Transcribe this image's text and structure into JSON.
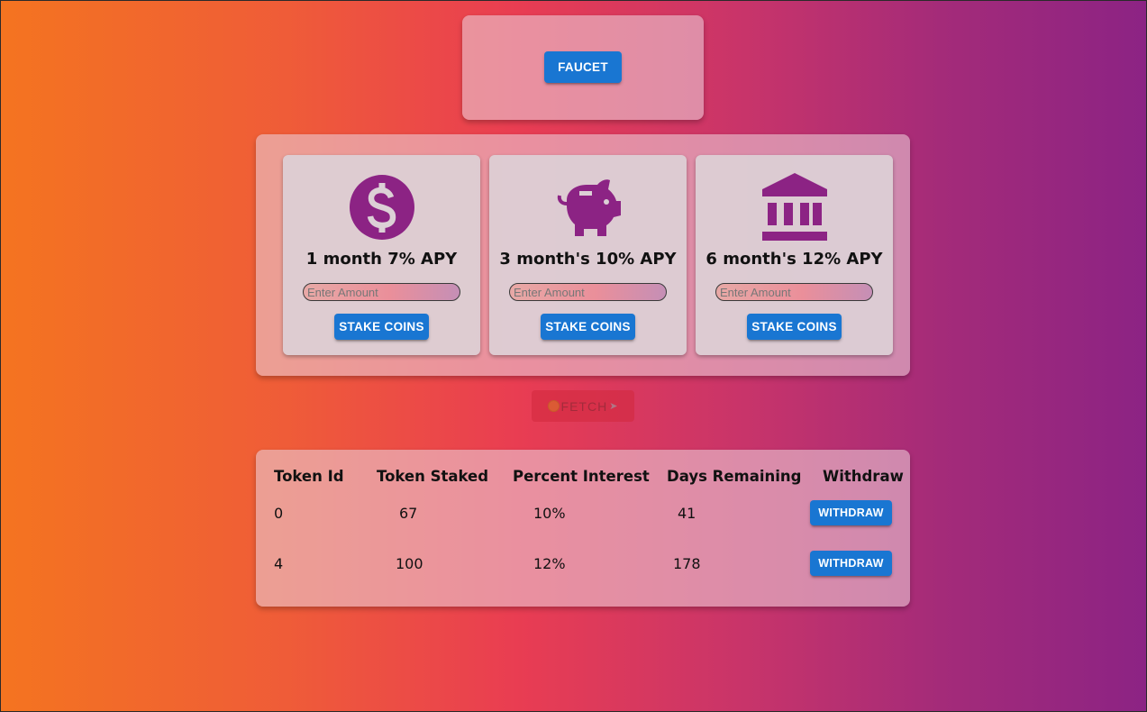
{
  "faucet": {
    "label": "FAUCET"
  },
  "plans": [
    {
      "icon": "dollar-circle-icon",
      "label": "1 month 7% APY",
      "placeholder": "Enter Amount",
      "button": "STAKE COINS"
    },
    {
      "icon": "piggy-bank-icon",
      "label": "3 month's 10% APY",
      "placeholder": "Enter Amount",
      "button": "STAKE COINS"
    },
    {
      "icon": "bank-icon",
      "label": "6 month's 12% APY",
      "placeholder": "Enter Amount",
      "button": "STAKE COINS"
    }
  ],
  "fetch": {
    "label": "FETCH"
  },
  "table": {
    "headers": [
      "Token Id",
      "Token Staked",
      "Percent Interest",
      "Days Remaining",
      "Withdraw"
    ],
    "rows": [
      {
        "token_id": "0",
        "token_staked": "67",
        "percent_interest": "10%",
        "days_remaining": "41",
        "action": "WITHDRAW"
      },
      {
        "token_id": "4",
        "token_staked": "100",
        "percent_interest": "12%",
        "days_remaining": "178",
        "action": "WITHDRAW"
      }
    ]
  },
  "colors": {
    "primary_button": "#1976d2",
    "icon_purple": "#8c2384",
    "gradient_left": "#f47420",
    "gradient_right": "#8c2384"
  }
}
